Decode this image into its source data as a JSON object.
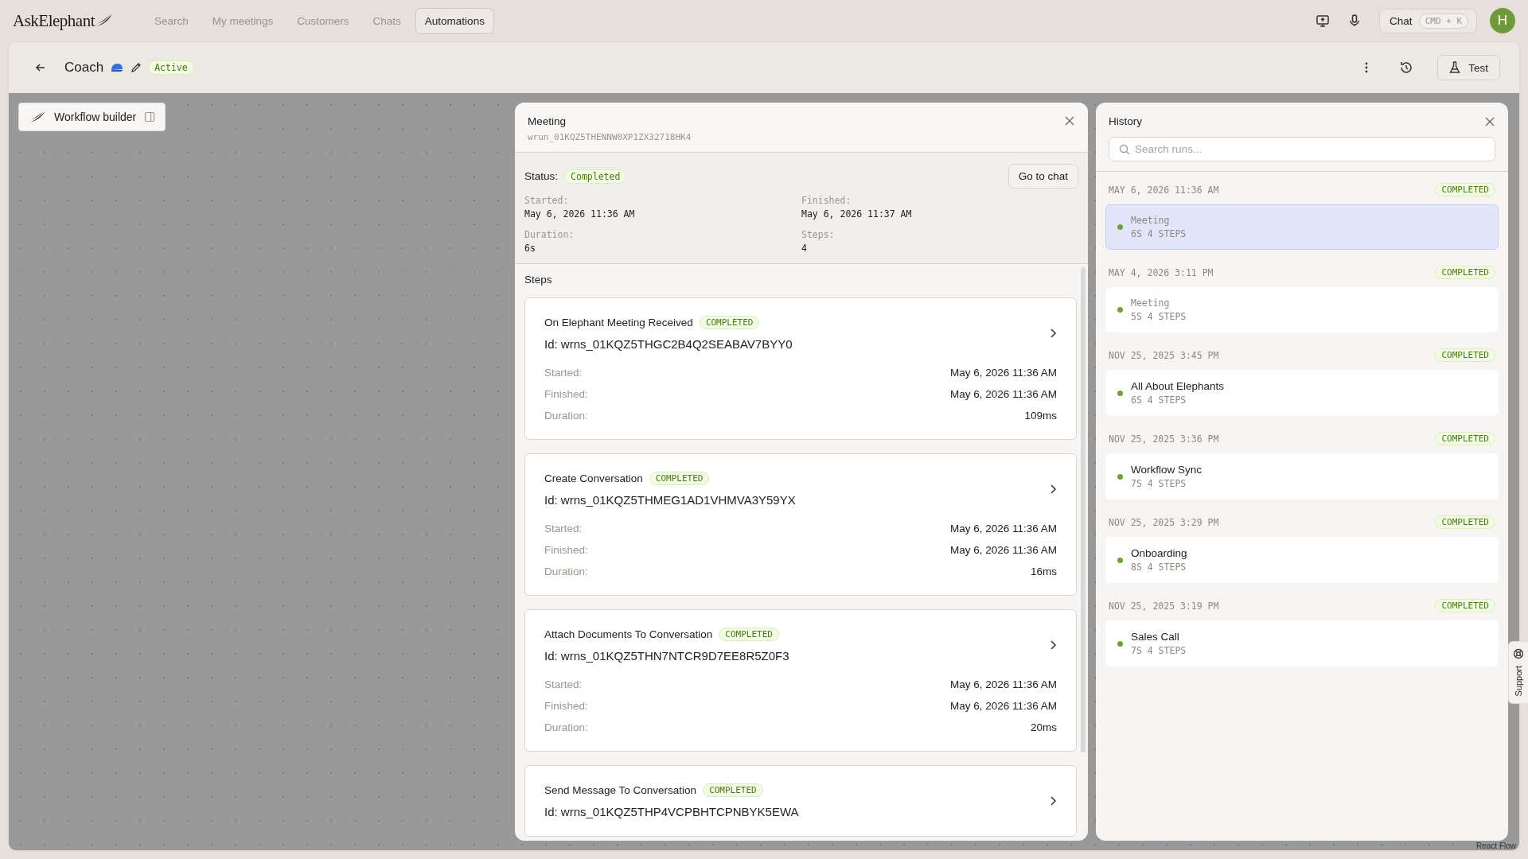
{
  "app": {
    "logo": "AskElephant",
    "nav": [
      {
        "label": "Search",
        "selected": false
      },
      {
        "label": "My meetings",
        "selected": false
      },
      {
        "label": "Customers",
        "selected": false
      },
      {
        "label": "Chats",
        "selected": false
      },
      {
        "label": "Automations",
        "selected": true
      }
    ],
    "chat_button": "Chat",
    "shortcut": "CMD + K",
    "avatar": "H"
  },
  "header": {
    "title": "Coach",
    "status": "Active",
    "test_button": "Test"
  },
  "canvas": {
    "builder_label": "Workflow builder",
    "attribution": "React Flow"
  },
  "run_panel": {
    "title": "Meeting",
    "run_id": "wrun_01KQZ5THENNW0XP1ZX32718HK4",
    "status_label": "Status:",
    "status": "Completed",
    "go_to_chat": "Go to chat",
    "details": [
      {
        "label": "Started:",
        "value": "May 6, 2026 11:36 AM"
      },
      {
        "label": "Finished:",
        "value": "May 6, 2026 11:37 AM"
      },
      {
        "label": "Duration:",
        "value": "6s"
      },
      {
        "label": "Steps:",
        "value": "4"
      }
    ],
    "steps_title": "Steps",
    "steps": [
      {
        "name": "On Elephant Meeting Received",
        "status": "COMPLETED",
        "id": "Id: wrns_01KQZ5THGC2B4Q2SEABAV7BYY0",
        "rows": [
          {
            "label": "Started:",
            "value": "May 6, 2026 11:36 AM"
          },
          {
            "label": "Finished:",
            "value": "May 6, 2026 11:36 AM"
          },
          {
            "label": "Duration:",
            "value": "109ms"
          }
        ]
      },
      {
        "name": "Create Conversation",
        "status": "COMPLETED",
        "id": "Id: wrns_01KQZ5THMEG1AD1VHMVA3Y59YX",
        "rows": [
          {
            "label": "Started:",
            "value": "May 6, 2026 11:36 AM"
          },
          {
            "label": "Finished:",
            "value": "May 6, 2026 11:36 AM"
          },
          {
            "label": "Duration:",
            "value": "16ms"
          }
        ]
      },
      {
        "name": "Attach Documents To Conversation",
        "status": "COMPLETED",
        "id": "Id: wrns_01KQZ5THN7NTCR9D7EE8R5Z0F3",
        "rows": [
          {
            "label": "Started:",
            "value": "May 6, 2026 11:36 AM"
          },
          {
            "label": "Finished:",
            "value": "May 6, 2026 11:36 AM"
          },
          {
            "label": "Duration:",
            "value": "20ms"
          }
        ]
      },
      {
        "name": "Send Message To Conversation",
        "status": "COMPLETED",
        "id": "Id: wrns_01KQZ5THP4VCPBHTCPNBYK5EWA"
      }
    ]
  },
  "history": {
    "title": "History",
    "search_placeholder": "Search runs...",
    "runs": [
      {
        "date": "MAY 6, 2026 11:36 AM",
        "status": "COMPLETED",
        "name": "Meeting",
        "kind": "untitled",
        "meta": "6S 4 STEPS",
        "selected": true
      },
      {
        "date": "MAY 4, 2026 3:11 PM",
        "status": "COMPLETED",
        "name": "Meeting",
        "kind": "untitled",
        "meta": "5S 4 STEPS",
        "selected": false
      },
      {
        "date": "NOV 25, 2025 3:45 PM",
        "status": "COMPLETED",
        "name": "All About Elephants",
        "kind": "named",
        "meta": "6S 4 STEPS",
        "selected": false
      },
      {
        "date": "NOV 25, 2025 3:36 PM",
        "status": "COMPLETED",
        "name": "Workflow Sync",
        "kind": "named",
        "meta": "7S 4 STEPS",
        "selected": false
      },
      {
        "date": "NOV 25, 2025 3:29 PM",
        "status": "COMPLETED",
        "name": "Onboarding",
        "kind": "named",
        "meta": "8S 4 STEPS",
        "selected": false
      },
      {
        "date": "NOV 25, 2025 3:19 PM",
        "status": "COMPLETED",
        "name": "Sales Call",
        "kind": "named",
        "meta": "7S 4 STEPS",
        "selected": false
      }
    ]
  },
  "support": "Support"
}
